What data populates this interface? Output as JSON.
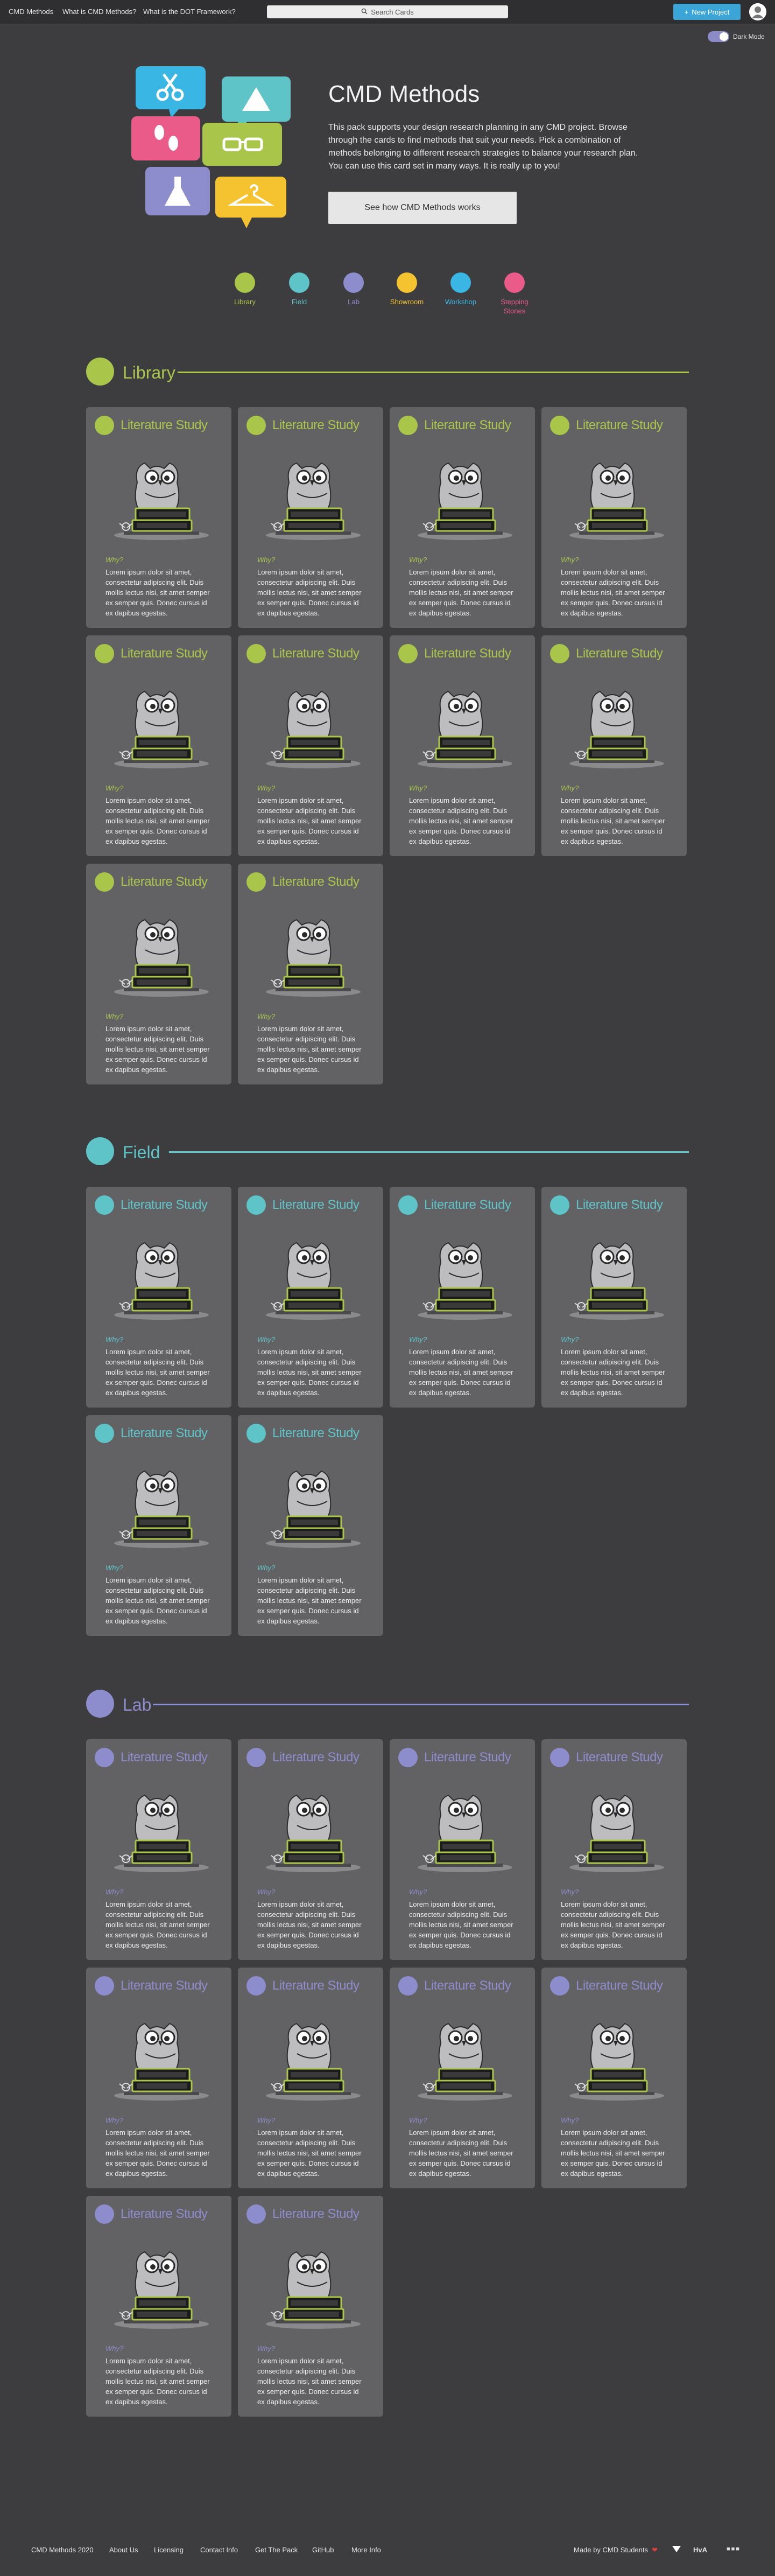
{
  "nav": {
    "brand": "CMD Methods",
    "links": [
      "What is CMD Methods?",
      "What is the DOT Framework?"
    ],
    "search_placeholder": "Search Cards",
    "new_project": "New Project",
    "dark_mode": "Dark Mode"
  },
  "hero": {
    "title": "CMD Methods",
    "description": "This pack supports your design research planning in any CMD project. Browse through the cards to find methods that suit your needs. Pick a combination of methods belonging to different research strategies to balance your research plan. You can use this card set in many ways. It is really up to you!",
    "button": "See how CMD Methods works"
  },
  "legend": [
    {
      "label": "Library",
      "color": "#a9c64a"
    },
    {
      "label": "Field",
      "color": "#5ec4c8"
    },
    {
      "label": "Lab",
      "color": "#8d8ccc"
    },
    {
      "label": "Showroom",
      "color": "#f5c230"
    },
    {
      "label": "Workshop",
      "color": "#39b6e3"
    },
    {
      "label": "Stepping Stones",
      "color": "#ea5b8a"
    }
  ],
  "sections": [
    {
      "name": "Library",
      "color": "#a9c64a",
      "count": 10
    },
    {
      "name": "Field",
      "color": "#5ec4c8",
      "count": 6
    },
    {
      "name": "Lab",
      "color": "#8d8ccc",
      "count": 10
    }
  ],
  "card": {
    "title": "Literature Study",
    "why": "Why?",
    "text": "Lorem ipsum dolor sit amet, consectetur adipiscing elit. Duis mollis lectus nisi, sit amet semper ex semper quis. Donec cursus id ex dapibus egestas."
  },
  "footer": {
    "links": [
      "CMD Methods 2020",
      "About Us",
      "Licensing",
      "Contact Info",
      "Get The Pack",
      "GitHub",
      "More Info"
    ],
    "made_by": "Made by CMD Students",
    "brand": "HvA"
  }
}
